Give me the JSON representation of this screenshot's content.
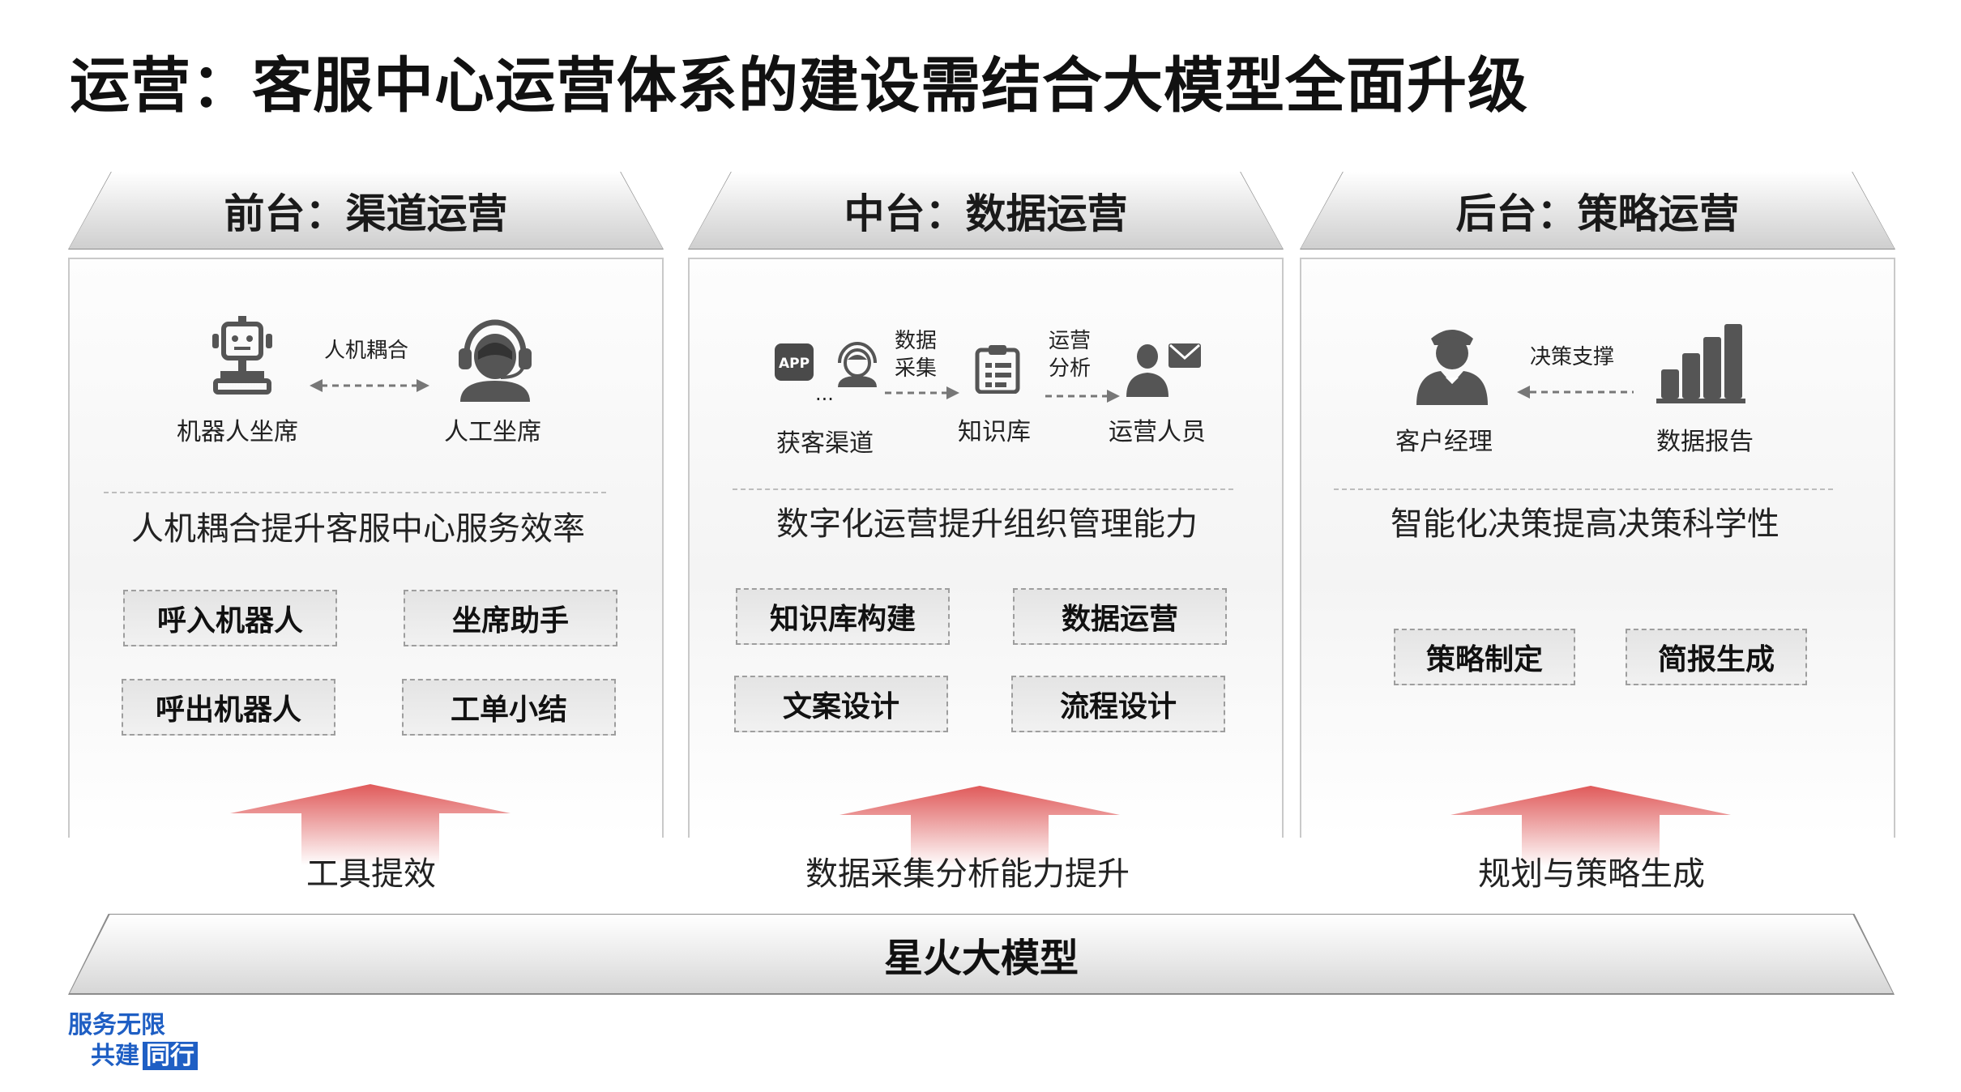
{
  "title": "运营：客服中心运营体系的建设需结合大模型全面升级",
  "columns": [
    {
      "header": "前台：渠道运营",
      "icon_left_label": "机器人坐席",
      "icon_right_label": "人工坐席",
      "arrow_label": "人机耦合",
      "headline": "人机耦合提升客服中心服务效率",
      "boxes": [
        "呼入机器人",
        "坐席助手",
        "呼出机器人",
        "工单小结"
      ],
      "bottom": "工具提效",
      "icons": [
        "robot-icon",
        "headset-agent-icon"
      ]
    },
    {
      "header": "中台：数据运营",
      "icon_a_label": "获客渠道",
      "icon_a_more": "...",
      "arrow1_label": [
        "数据",
        "采集"
      ],
      "icon_b_label": "知识库",
      "arrow2_label": [
        "运营",
        "分析"
      ],
      "icon_c_label": "运营人员",
      "headline": "数字化运营提升组织管理能力",
      "boxes": [
        "知识库构建",
        "数据运营",
        "文案设计",
        "流程设计"
      ],
      "bottom": "数据采集分析能力提升",
      "icons": [
        "app-icon",
        "customer-icon",
        "clipboard-icon",
        "operator-mail-icon"
      ],
      "app_text": "APP"
    },
    {
      "header": "后台：策略运营",
      "icon_left_label": "客户经理",
      "icon_right_label": "数据报告",
      "arrow_label": "决策支撑",
      "headline": "智能化决策提高决策科学性",
      "boxes": [
        "策略制定",
        "简报生成"
      ],
      "bottom": "规划与策略生成",
      "icons": [
        "manager-icon",
        "bar-chart-icon"
      ]
    }
  ],
  "base_label": "星火大模型",
  "logo": {
    "line1": "服务无限",
    "line2": "共建",
    "line2_highlight": "同行"
  },
  "colors": {
    "arrow_red": "#e05a5a",
    "logo_blue": "#1f5fc4"
  }
}
